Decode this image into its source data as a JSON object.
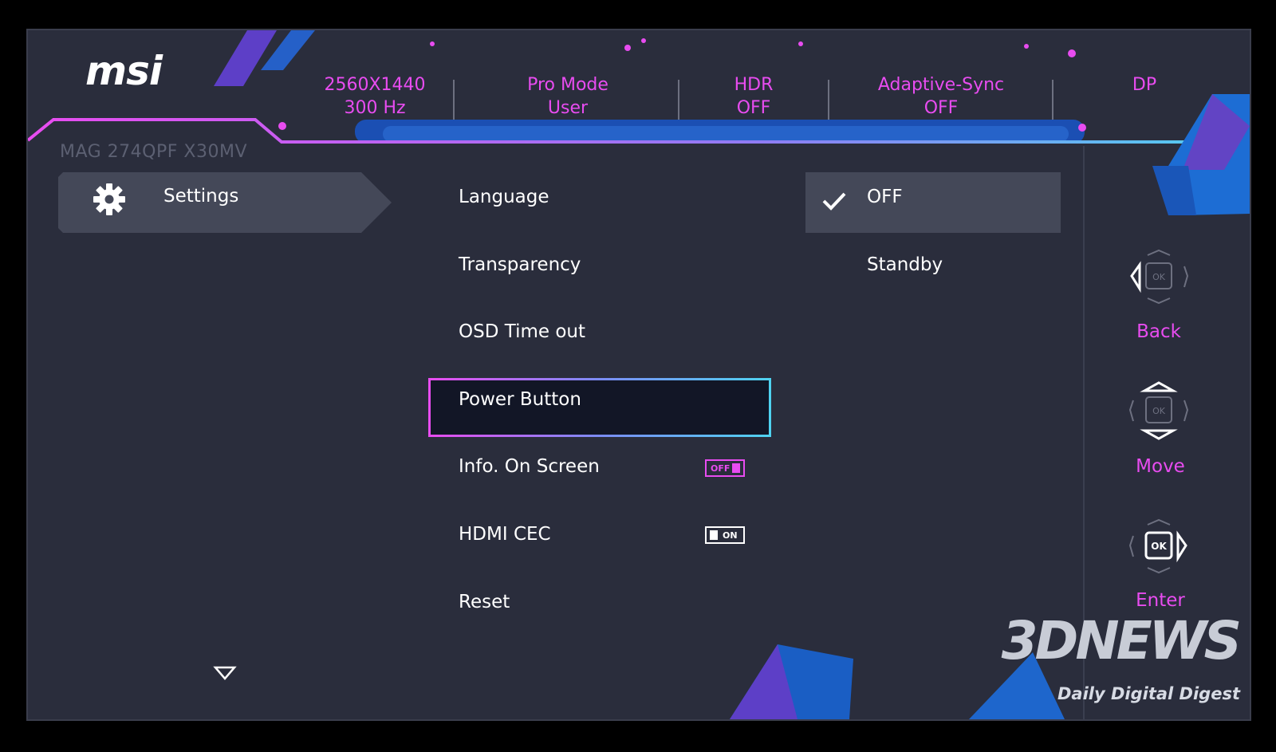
{
  "brand": {
    "logo_text": "msi"
  },
  "status_bar": [
    {
      "line1": "2560X1440",
      "line2": "300 Hz"
    },
    {
      "line1": "Pro Mode",
      "line2": "User"
    },
    {
      "line1": "HDR",
      "line2": "OFF"
    },
    {
      "line1": "Adaptive-Sync",
      "line2": "OFF"
    },
    {
      "line1": "DP",
      "line2": ""
    }
  ],
  "model": "MAG 274QPF X30MV",
  "category": {
    "label": "Settings",
    "icon": "gear-icon"
  },
  "menu_items": [
    {
      "label": "Language"
    },
    {
      "label": "Transparency"
    },
    {
      "label": "OSD Time out"
    },
    {
      "label": "Power Button",
      "selected": true
    },
    {
      "label": "Info. On Screen",
      "toggle": "OFF"
    },
    {
      "label": "HDMI CEC",
      "toggle": "ON"
    },
    {
      "label": "Reset"
    }
  ],
  "options": [
    {
      "label": "OFF",
      "checked": true
    },
    {
      "label": "Standby",
      "checked": false
    }
  ],
  "controls": [
    {
      "label": "Back",
      "icon": "ok-left-icon"
    },
    {
      "label": "Move",
      "icon": "ok-updown-icon"
    },
    {
      "label": "Enter",
      "icon": "ok-right-icon"
    }
  ],
  "watermark": {
    "logo": "3DNEWS",
    "tagline": "Daily Digital Digest"
  },
  "colors": {
    "accent": "#e84cf0",
    "cyan": "#4fd2f0",
    "background": "#2a2d3c",
    "highlight": "#444858"
  }
}
